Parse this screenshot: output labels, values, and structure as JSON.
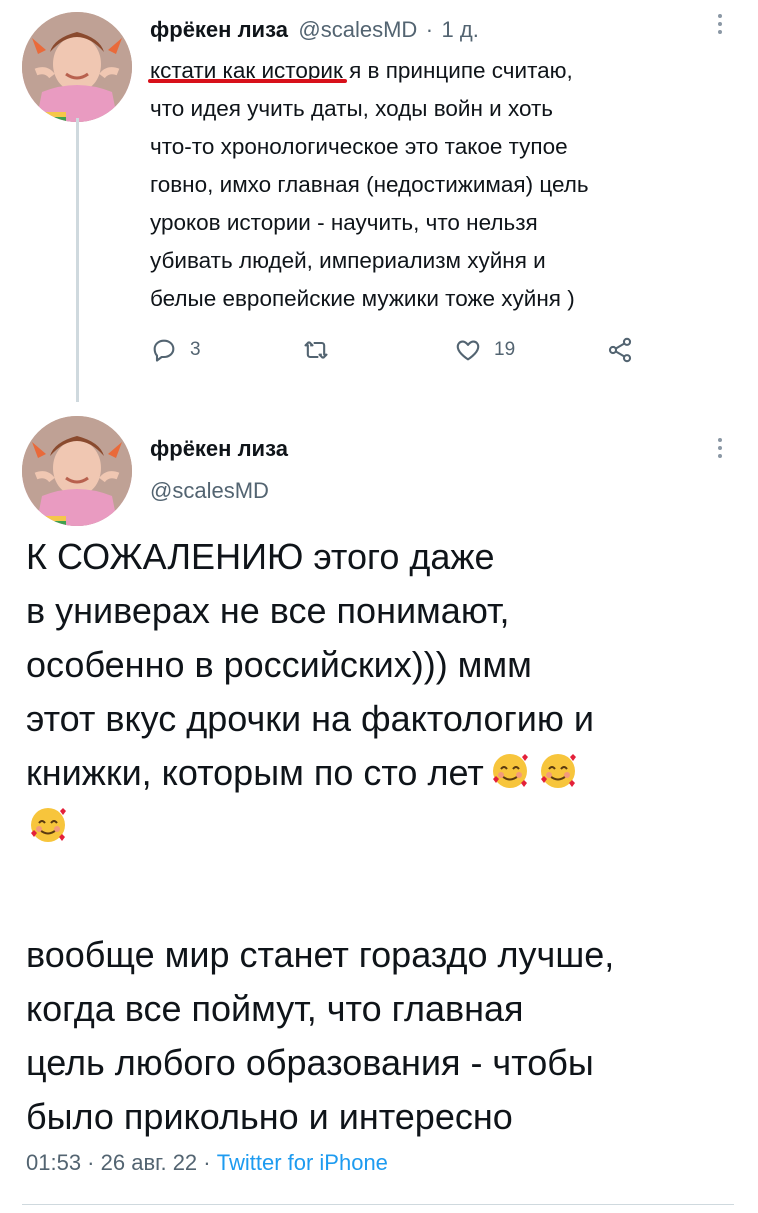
{
  "tweet1": {
    "display_name": "фрёкен лиза",
    "handle": "@scalesMD",
    "separator": "·",
    "time": "1 д.",
    "text_underlined": "кстати как историк",
    "text_lines": [
      " я в принципе считаю,",
      "что идея учить даты, ходы войн и хоть",
      "что-то хронологическое это такое тупое",
      "говно, имхо главная (недостижимая) цель",
      "уроков истории - научить, что нельзя",
      "убивать людей, империализм хуйня и",
      "белые европейские мужики тоже хуйня )"
    ],
    "actions": {
      "reply_count": "3",
      "retweet_count": "",
      "like_count": "19"
    },
    "icons": [
      "reply-icon",
      "retweet-icon",
      "like-icon",
      "share-icon",
      "more-icon"
    ]
  },
  "tweet2": {
    "display_name": "фрёкен лиза",
    "handle": "@scalesMD",
    "text_lines": [
      "К СОЖАЛЕНИЮ этого даже",
      "в универах не все понимают,",
      "особенно в российских))) ммм",
      "этот вкус дрочки на фактологию и",
      "книжки, которым по сто лет"
    ],
    "emojis": [
      "smiling-face-with-hearts-emoji",
      "smiling-face-with-hearts-emoji",
      "smiling-face-with-hearts-emoji"
    ],
    "text_lines_2": [
      "вообще мир станет гораздо лучше,",
      "когда все поймут, что главная",
      "цель любого образования - чтобы",
      "было прикольно и интересно"
    ],
    "timestamp": "01:53",
    "dot1": " · ",
    "date": "26 авг. 22",
    "dot2": " · ",
    "source": "Twitter for iPhone"
  },
  "colors": {
    "text": "#0f1419",
    "secondary": "#536471",
    "link": "#1d9bf0",
    "underline": "#d8101a",
    "thread_line": "#cfd9de"
  }
}
